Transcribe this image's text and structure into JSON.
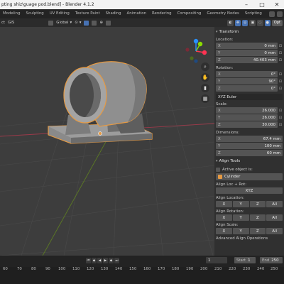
{
  "window": {
    "title": "pting shiz\\guage pod.blend] - Blender 4.1.2",
    "minimize": "–",
    "maximize": "□",
    "close": "✕"
  },
  "workspaces": [
    {
      "label": "Modeling",
      "active": false
    },
    {
      "label": "Sculpting",
      "active": false
    },
    {
      "label": "UV Editing",
      "active": false
    },
    {
      "label": "Texture Paint",
      "active": false
    },
    {
      "label": "Shading",
      "active": false
    },
    {
      "label": "Animation",
      "active": false
    },
    {
      "label": "Rendering",
      "active": false
    },
    {
      "label": "Compositing",
      "active": false
    },
    {
      "label": "Geometry Nodes",
      "active": false
    },
    {
      "label": "Scripting",
      "active": false
    }
  ],
  "viewport_header": {
    "object_label": "ct",
    "mode_label": "GIS",
    "orientation": "Global",
    "pivot": "⊙",
    "snap": "⊕"
  },
  "npanel_header": {
    "options": "Opt"
  },
  "transform": {
    "title": "Transform",
    "location_label": "Location:",
    "location": [
      {
        "axis": "X",
        "value": "0 mm"
      },
      {
        "axis": "Y",
        "value": "0 mm"
      },
      {
        "axis": "Z",
        "value": "40.403 mm"
      }
    ],
    "rotation_label": "Rotation:",
    "rotation": [
      {
        "axis": "X",
        "value": "0°"
      },
      {
        "axis": "Y",
        "value": "90°"
      },
      {
        "axis": "Z",
        "value": "0°"
      }
    ],
    "rotation_mode": "XYZ Euler",
    "scale_label": "Scale:",
    "scale": [
      {
        "axis": "X",
        "value": "26.000"
      },
      {
        "axis": "Y",
        "value": "26.000"
      },
      {
        "axis": "Z",
        "value": "30.000"
      }
    ],
    "dimensions_label": "Dimensions:",
    "dimensions": [
      {
        "axis": "X",
        "value": "67.4 mm"
      },
      {
        "axis": "Y",
        "value": "100 mm"
      },
      {
        "axis": "Z",
        "value": "60 mm"
      }
    ]
  },
  "align_tools": {
    "title": "Align Tools",
    "active_object_label": "Active object is:",
    "active_object": "Cylinder",
    "align_loc_rot_label": "Align Loc + Rot:",
    "align_loc_rot_value": "XYZ",
    "align_location_label": "Align Location:",
    "align_rotation_label": "Align Rotation:",
    "align_scale_label": "Align Scale:",
    "axis_buttons": [
      "X",
      "Y",
      "Z",
      "All"
    ],
    "advanced_label": "Advanced Align Operations"
  },
  "timeline": {
    "frame_ticks": [
      "60",
      "70",
      "80",
      "90",
      "100",
      "110",
      "120",
      "130",
      "140",
      "150",
      "160",
      "170",
      "180",
      "190",
      "200",
      "210",
      "220",
      "230",
      "240",
      "250"
    ],
    "current_frame": "1",
    "start_label": "Start",
    "start_value": "1",
    "end_label": "End",
    "end_value": "250"
  },
  "colors": {
    "viewport_bg": "#3d3d3d",
    "selection_outline": "#e69a43",
    "x_axis": "#ff3352",
    "y_axis": "#8bdc00",
    "z_axis": "#2890ff"
  }
}
